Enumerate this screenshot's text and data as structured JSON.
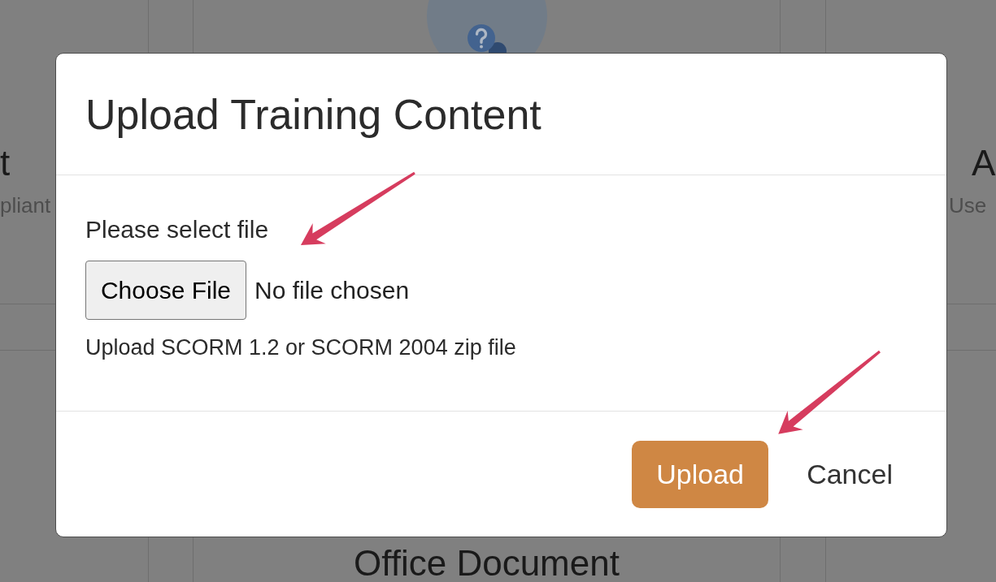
{
  "background_page": {
    "left_card": {
      "title": "t",
      "description": "pliant"
    },
    "right_card": {
      "title": "A",
      "description": "Use"
    },
    "lower_card": {
      "title": "Office Document"
    }
  },
  "dialog": {
    "title": "Upload Training Content",
    "file_field": {
      "label": "Please select file",
      "button": "Choose File",
      "status": "No file chosen",
      "hint": "Upload SCORM 1.2 or SCORM 2004 zip file"
    },
    "buttons": [
      {
        "label": "Upload",
        "kind": "primary"
      },
      {
        "label": "Cancel",
        "kind": "link"
      }
    ]
  }
}
